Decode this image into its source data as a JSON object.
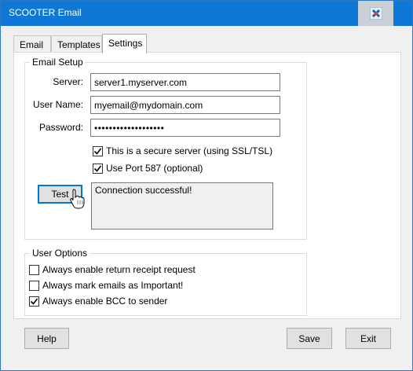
{
  "window": {
    "title": "SCOOTER Email"
  },
  "tabs": [
    {
      "label": "Email"
    },
    {
      "label": "Templates"
    },
    {
      "label": "Settings"
    }
  ],
  "email_setup": {
    "title": "Email Setup",
    "server_label": "Server:",
    "server_value": "server1.myserver.com",
    "username_label": "User Name:",
    "username_value": "myemail@mydomain.com",
    "password_label": "Password:",
    "password_value": "•••••••••••••••••••",
    "secure_server": {
      "label": "This is a secure server (using SSL/TSL)",
      "checked": true
    },
    "port_587": {
      "label": "Use Port 587 (optional)",
      "checked": true
    },
    "test_button": "Test",
    "test_result": "Connection successful!"
  },
  "user_options": {
    "title": "User Options",
    "items": [
      {
        "label": "Always enable return receipt request",
        "checked": false
      },
      {
        "label": "Always mark emails as Important!",
        "checked": false
      },
      {
        "label": "Always enable BCC to sender",
        "checked": true
      }
    ]
  },
  "buttons": {
    "help": "Help",
    "save": "Save",
    "exit": "Exit"
  },
  "colors": {
    "titlebar": "#0f78d7",
    "focus": "#0078d7"
  }
}
